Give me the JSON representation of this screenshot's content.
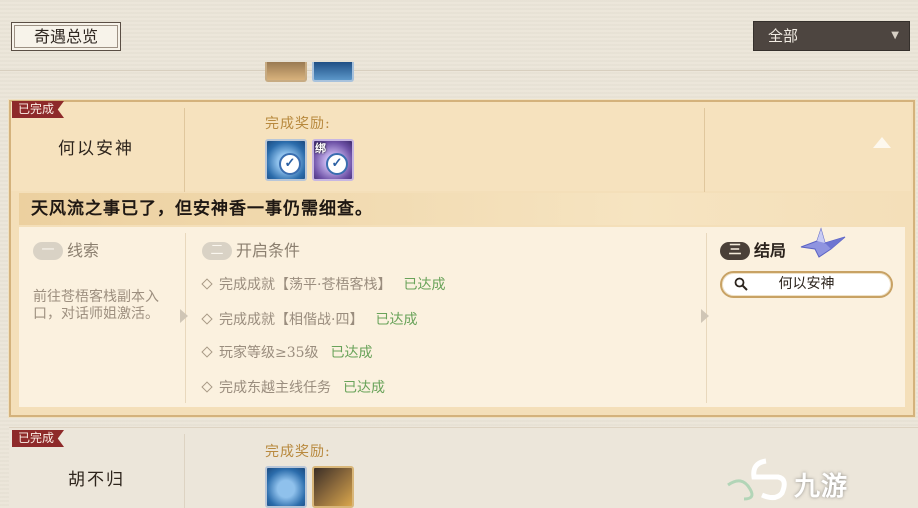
{
  "header": {
    "title": "奇遇总览",
    "filter_value": "全部"
  },
  "quests": [
    {
      "status": "已完成",
      "name": "何以安神",
      "reward_label": "完成奖励:",
      "rewards": [
        {
          "icon": "blue-token-icon",
          "bound": "",
          "completed": true
        },
        {
          "icon": "purple-token-icon",
          "bound": "绑",
          "completed": true
        }
      ],
      "description": "天风流之事已了，但安神香一事仍需细查。",
      "sections": {
        "clue": {
          "number": "一",
          "title": "线索",
          "text": "前往苍梧客栈副本入口，对话师姐激活。"
        },
        "conditions": {
          "number": "二",
          "title": "开启条件",
          "items": [
            {
              "text": "完成成就【荡平·苍梧客栈】",
              "status": "已达成"
            },
            {
              "text": "完成成就【相偕战·四】",
              "status": "已达成"
            },
            {
              "text": "玩家等级≥35级",
              "status": "已达成"
            },
            {
              "text": "完成东越主线任务",
              "status": "已达成"
            }
          ]
        },
        "result": {
          "number": "三",
          "title": "结局",
          "value": "何以安神"
        }
      }
    },
    {
      "status": "已完成",
      "name": "胡不归",
      "reward_label": "完成奖励:"
    }
  ],
  "watermark": "九游",
  "colors": {
    "accent_gold": "#d4b27c",
    "done_tag": "#8e2a2a",
    "achieved_green": "#69a35a",
    "filter_bg": "#4d4540"
  }
}
